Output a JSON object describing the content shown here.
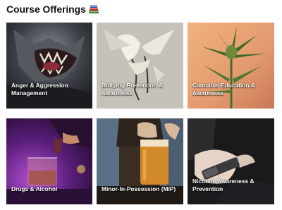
{
  "page": {
    "heading": "Course Offerings",
    "heading_icon": "books-icon"
  },
  "courses": [
    {
      "label": "Anger & Aggression\nManagement",
      "image": "snarling-wolf-photo",
      "accent": "#6b6f78"
    },
    {
      "label": "Bullying Prevention &\nAwareness",
      "image": "fighting-birds-photo",
      "accent": "#c9c3b8"
    },
    {
      "label": "Cannabis Education &\nAwareness",
      "image": "cannabis-plant-photo",
      "accent": "#e3a27a"
    },
    {
      "label": "Drugs & Alcohol",
      "image": "pouring-drink-purple-photo",
      "accent": "#7a2a9a"
    },
    {
      "label": "Minor-In-Possession (MIP)",
      "image": "person-holding-beer-photo",
      "accent": "#b87a2a"
    },
    {
      "label": "Nicotine Awareness &\nPrevention",
      "image": "hand-vape-device-photo",
      "accent": "#333333"
    }
  ]
}
